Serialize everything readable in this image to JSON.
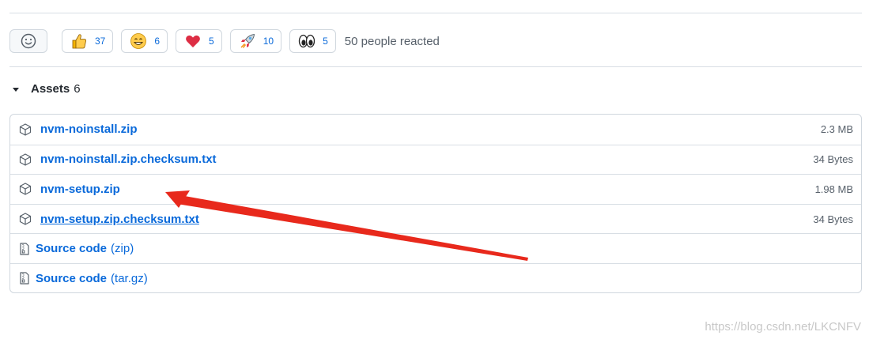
{
  "reactions": {
    "items": [
      {
        "icon": "thumbs-up-icon",
        "count": "37"
      },
      {
        "icon": "smile-icon",
        "count": "6"
      },
      {
        "icon": "heart-icon",
        "count": "5"
      },
      {
        "icon": "rocket-icon",
        "count": "10"
      },
      {
        "icon": "eyes-icon",
        "count": "5"
      }
    ],
    "summary": "50 people reacted"
  },
  "assets": {
    "title": "Assets",
    "count": "6",
    "files": [
      {
        "name": "nvm-noinstall.zip",
        "size": "2.3 MB"
      },
      {
        "name": "nvm-noinstall.zip.checksum.txt",
        "size": "34 Bytes"
      },
      {
        "name": "nvm-setup.zip",
        "size": "1.98 MB"
      },
      {
        "name": "nvm-setup.zip.checksum.txt",
        "size": "34 Bytes"
      }
    ],
    "source": [
      {
        "label": "Source code",
        "suffix": "(zip)"
      },
      {
        "label": "Source code",
        "suffix": "(tar.gz)"
      }
    ]
  },
  "annotation": {
    "color": "#e8291c"
  },
  "watermark": "https://blog.csdn.net/LKCNFV",
  "colors": {
    "link": "#0969da",
    "muted": "#57606a",
    "border": "#d0d7de"
  }
}
